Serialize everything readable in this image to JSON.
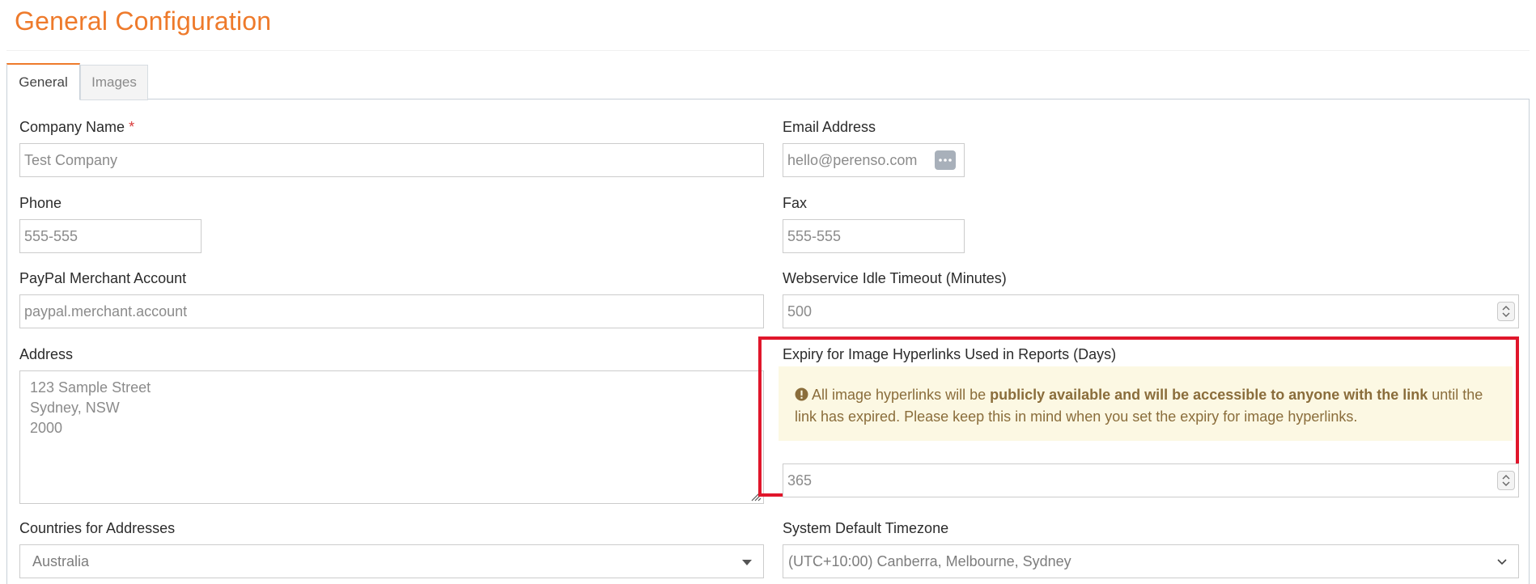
{
  "page": {
    "title": "General Configuration",
    "accent_color": "#ee7a2b",
    "highlight_color": "#e0162b"
  },
  "tabs": [
    {
      "label": "General",
      "active": true
    },
    {
      "label": "Images",
      "active": false
    }
  ],
  "form": {
    "company_name": {
      "label": "Company Name",
      "required_mark": "*",
      "value": "Test Company"
    },
    "email": {
      "label": "Email Address",
      "value": "hello@perenso.com",
      "button_icon": "more-dots-icon"
    },
    "phone": {
      "label": "Phone",
      "value": "555-555"
    },
    "fax": {
      "label": "Fax",
      "value": "555-555"
    },
    "paypal": {
      "label": "PayPal Merchant Account",
      "value": "paypal.merchant.account"
    },
    "webservice_timeout": {
      "label": "Webservice Idle Timeout (Minutes)",
      "value": "500"
    },
    "address": {
      "label": "Address",
      "lines": [
        "123 Sample Street",
        "Sydney, NSW",
        "2000"
      ]
    },
    "image_expiry": {
      "label": "Expiry for Image Hyperlinks Used in Reports (Days)",
      "warning_pre": "All image hyperlinks will be ",
      "warning_bold": "publicly available and will be accessible to anyone with the link",
      "warning_post": " until the link has expired. Please keep this in mind when you set the expiry for image hyperlinks.",
      "warning_icon": "exclamation-circle-icon",
      "value": "365"
    },
    "countries": {
      "label": "Countries for Addresses",
      "value": "Australia"
    },
    "timezone": {
      "label": "System Default Timezone",
      "value": "(UTC+10:00) Canberra, Melbourne, Sydney"
    }
  }
}
